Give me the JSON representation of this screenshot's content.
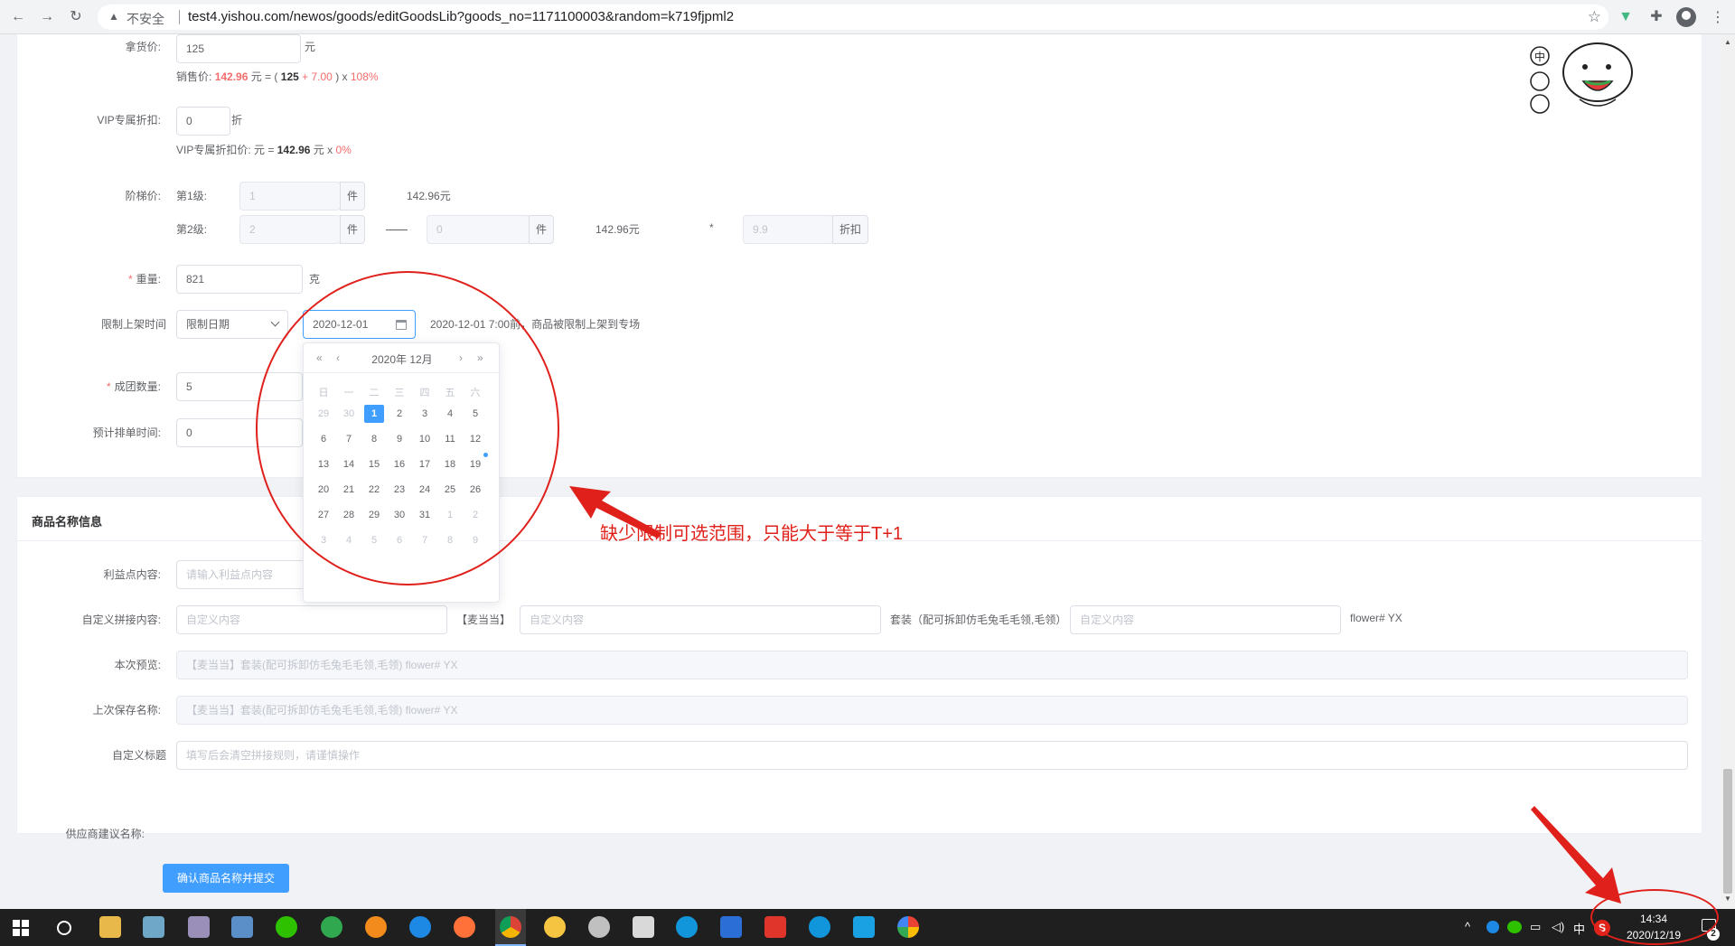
{
  "browser": {
    "insecure_label": "不安全",
    "url": "test4.yishou.com/newos/goods/editGoodsLib?goods_no=1171100003&random=k719fjpml2"
  },
  "price": {
    "purchase_label": "拿货价:",
    "purchase_value": "125",
    "purchase_unit": "元",
    "sale_label": "销售价:",
    "sale_value": "142.96",
    "sale_formula_prefix": "元 = (",
    "sale_formula_base": "125",
    "sale_formula_plus": "+ 7.00",
    "sale_formula_close": ") x",
    "sale_formula_pct": "108%"
  },
  "vip": {
    "label": "VIP专属折扣:",
    "value": "0",
    "unit": "折",
    "price_label": "VIP专属折扣价:",
    "price_prefix": "元 =",
    "price_value": "142.96",
    "price_mid": "元 x",
    "price_pct": "0%"
  },
  "tier": {
    "label": "阶梯价:",
    "level1_label": "第1级:",
    "level1_value": "1",
    "level1_unit": "件",
    "level1_price": "142.96元",
    "level2_label": "第2级:",
    "level2_value": "2",
    "level2_unit": "件",
    "level2_to_value": "0",
    "level2_to_unit": "件",
    "level2_price": "142.96元",
    "level2_star": "*",
    "discount_value": "9.9",
    "discount_unit": "折扣"
  },
  "weight": {
    "label": "重量:",
    "value": "821",
    "unit": "克"
  },
  "shelf_limit": {
    "label": "限制上架时间",
    "type_value": "限制日期",
    "date_value": "2020-12-01",
    "hint": "2020-12-01 7:00前，商品被限制上架到专场"
  },
  "group": {
    "label": "成团数量:",
    "value": "5"
  },
  "schedule": {
    "label": "预计排单时间:",
    "value": "0"
  },
  "datepicker": {
    "prev_year": "«",
    "prev_month": "‹",
    "title": "2020年 12月",
    "next_month": "›",
    "next_year": "»",
    "weekdays": [
      "日",
      "一",
      "二",
      "三",
      "四",
      "五",
      "六"
    ],
    "rows": [
      [
        "29",
        "30",
        "1",
        "2",
        "3",
        "4",
        "5"
      ],
      [
        "6",
        "7",
        "8",
        "9",
        "10",
        "11",
        "12"
      ],
      [
        "13",
        "14",
        "15",
        "16",
        "17",
        "18",
        "19"
      ],
      [
        "20",
        "21",
        "22",
        "23",
        "24",
        "25",
        "26"
      ],
      [
        "27",
        "28",
        "29",
        "30",
        "31",
        "1",
        "2"
      ],
      [
        "3",
        "4",
        "5",
        "6",
        "7",
        "8",
        "9"
      ]
    ]
  },
  "name_section": {
    "title": "商品名称信息",
    "benefit_label": "利益点内容:",
    "benefit_placeholder": "请输入利益点内容",
    "custom_label": "自定义拼接内容:",
    "custom_placeholder1": "自定义内容",
    "brand_tag": "【麦当当】",
    "custom_placeholder2": "自定义内容",
    "suit_text": "套装（配可拆卸仿毛兔毛毛领,毛领）",
    "custom_placeholder3": "自定义内容",
    "suffix_text": "flower#   YX",
    "preview_label": "本次预览:",
    "preview_value": "【麦当当】套装(配可拆卸仿毛兔毛毛领,毛领) flower#  YX",
    "last_saved_label": "上次保存名称:",
    "last_saved_value": "【麦当当】套装(配可拆卸仿毛兔毛毛领,毛领) flower#  YX",
    "custom_title_label": "自定义标题",
    "custom_title_placeholder": "填写后会清空拼接规则，请谨慎操作"
  },
  "supplier": {
    "label": "供应商建议名称:"
  },
  "submit_button": "确认商品名称并提交",
  "annotation": {
    "text": "缺少限制可选范围，只能大于等于T+1"
  },
  "taskbar": {
    "tray_lang": "中",
    "time": "14:34",
    "date": "2020/12/19",
    "notif_count": "2"
  },
  "colors": {
    "primary": "#409eff",
    "danger": "#f56c6c",
    "annotation": "#e0201b"
  }
}
